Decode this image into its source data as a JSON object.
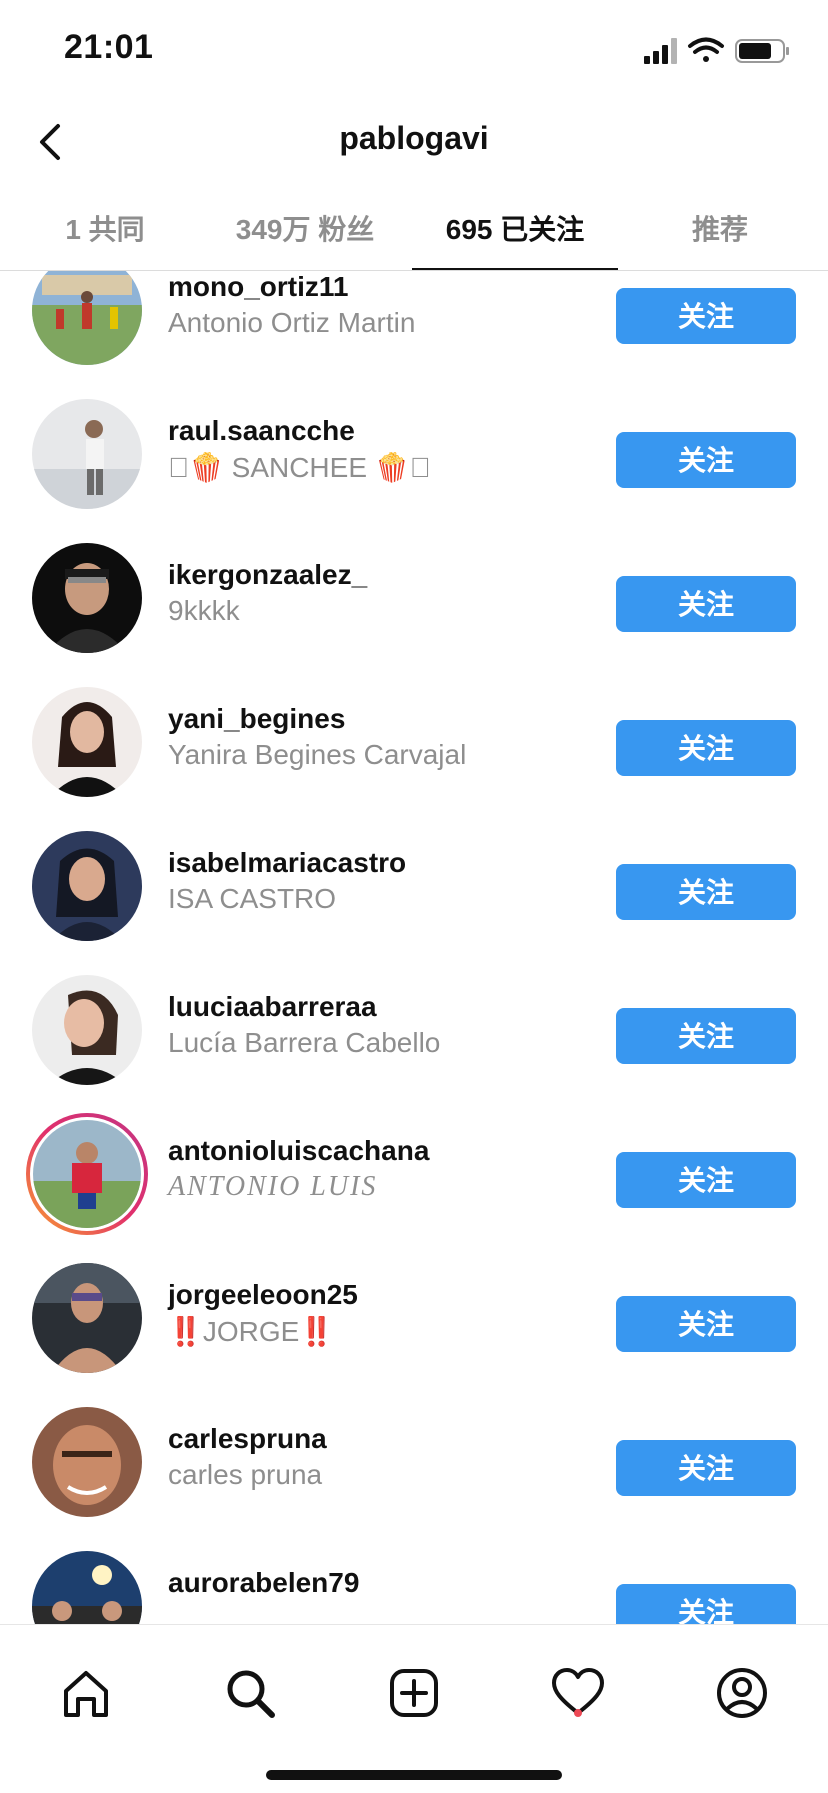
{
  "status_bar": {
    "time": "21:01"
  },
  "header": {
    "title": "pablogavi"
  },
  "tabs": [
    {
      "label": "1 共同"
    },
    {
      "label": "349万 粉丝"
    },
    {
      "label": "695 已关注"
    },
    {
      "label": "推荐"
    }
  ],
  "colors": {
    "accent": "#3897f0",
    "secondary_text": "#8e8e8e",
    "notification": "#ed4956"
  },
  "users": [
    {
      "username": "mono_ortiz11",
      "full_name": "Antonio Ortiz Martin",
      "button": "关注"
    },
    {
      "username": "raul.saancche",
      "full_name": "🍿 SANCHEE 🍿",
      "button": "关注"
    },
    {
      "username": "ikergonzaalez_",
      "full_name": "9kkkk",
      "button": "关注"
    },
    {
      "username": "yani_begines",
      "full_name": "Yanira Begines Carvajal",
      "button": "关注"
    },
    {
      "username": "isabelmariacastro",
      "full_name": "ISA CASTRO",
      "button": "关注"
    },
    {
      "username": "luuciaabarreraa",
      "full_name": "Lucía Barrera Cabello",
      "button": "关注"
    },
    {
      "username": "antonioluiscachana",
      "full_name": "ANTONIO LUIS",
      "button": "关注"
    },
    {
      "username": "jorgeeleoon25",
      "full_name": "‼️JORGE‼️",
      "button": "关注"
    },
    {
      "username": "carlespruna",
      "full_name": "carles pruna",
      "button": "关注"
    },
    {
      "username": "aurorabelen79",
      "full_name": "",
      "button": "关注"
    }
  ]
}
